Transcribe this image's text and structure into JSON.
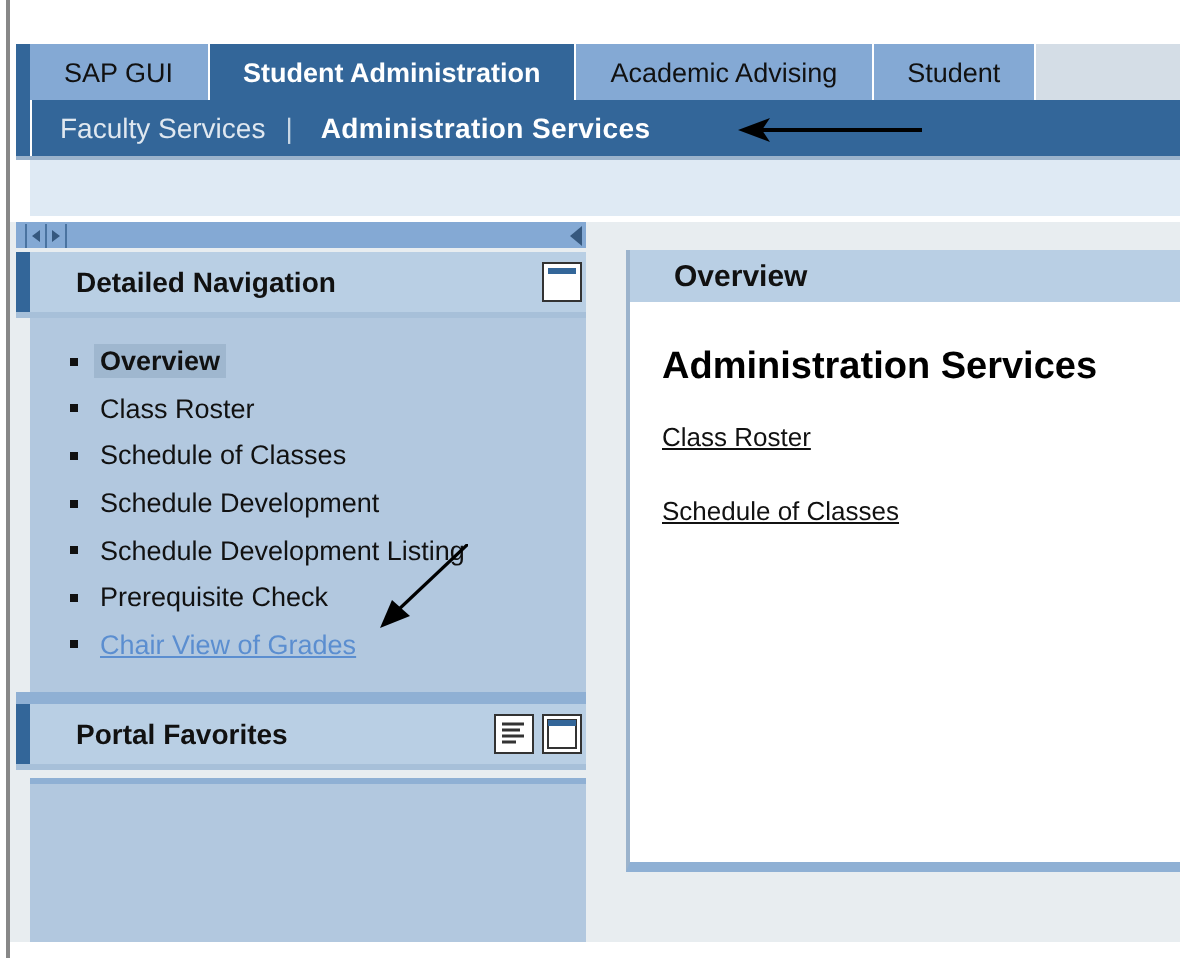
{
  "tabs": [
    {
      "label": "SAP GUI",
      "selected": false
    },
    {
      "label": "Student Administration",
      "selected": true
    },
    {
      "label": "Academic Advising",
      "selected": false
    },
    {
      "label": "Student",
      "selected": false
    }
  ],
  "subnav": {
    "separator": "|",
    "items": [
      {
        "label": "Faculty Services",
        "selected": false
      },
      {
        "label": "Administration Services",
        "selected": true
      }
    ]
  },
  "detailed_navigation": {
    "title": "Detailed Navigation",
    "items": [
      {
        "label": "Overview",
        "selected": true,
        "kind": "text"
      },
      {
        "label": "Class Roster",
        "selected": false,
        "kind": "text"
      },
      {
        "label": "Schedule of Classes",
        "selected": false,
        "kind": "text"
      },
      {
        "label": "Schedule Development",
        "selected": false,
        "kind": "text"
      },
      {
        "label": "Schedule Development Listing",
        "selected": false,
        "kind": "text"
      },
      {
        "label": "Prerequisite Check",
        "selected": false,
        "kind": "text"
      },
      {
        "label": "Chair View of Grades",
        "selected": false,
        "kind": "link"
      }
    ]
  },
  "portal_favorites": {
    "title": "Portal Favorites"
  },
  "overview": {
    "title": "Overview",
    "heading": "Administration Services",
    "links": [
      "Class Roster",
      "Schedule of Classes"
    ]
  }
}
